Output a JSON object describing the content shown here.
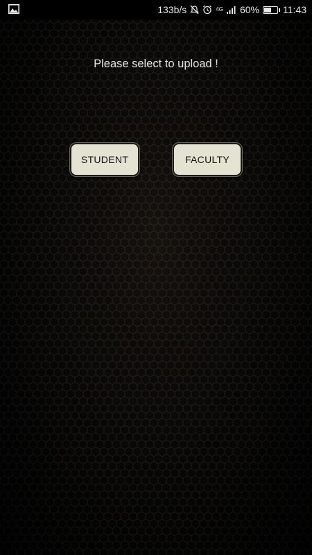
{
  "status_bar": {
    "gallery_icon": "image-icon",
    "network_speed": "133b/s",
    "mute_icon": "mute-icon",
    "alarm_icon": "alarm-icon",
    "network_type": "4G",
    "signal_icon": "signal-icon",
    "battery_percent": "60%",
    "battery_level": 0.6,
    "time": "11:43"
  },
  "main": {
    "prompt": "Please select to upload !",
    "buttons": {
      "student": "STUDENT",
      "faculty": "FACULTY"
    }
  },
  "colors": {
    "background": "#0a0a0a",
    "button_bg": "#e4e3d2",
    "prompt_text": "#e6e6e6"
  }
}
